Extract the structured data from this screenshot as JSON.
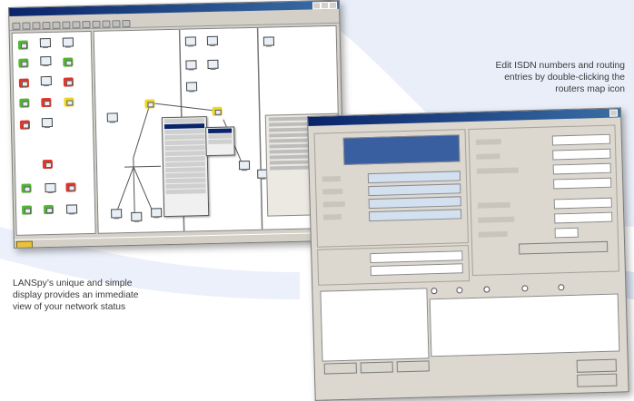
{
  "captions": {
    "top_right": [
      "Edit ISDN numbers and routing",
      "entries by double-clicking the",
      "routers map icon"
    ],
    "bottom_left": [
      "LANSpy’s unique and simple",
      "display provides an immediate",
      "view of your network status"
    ]
  },
  "icons": {
    "pointer_up": "triangle-up",
    "pointer_down": "triangle-down"
  },
  "colors": {
    "caption_text": "#3b3b3b",
    "pointer": "#8a8fa3",
    "background_swoosh": "#e3eaf8",
    "node_red": "#e03528",
    "node_green": "#52b632",
    "node_yellow": "#efd823",
    "title_bar": "#0a246a",
    "selected_field": "#3a5fa0"
  }
}
